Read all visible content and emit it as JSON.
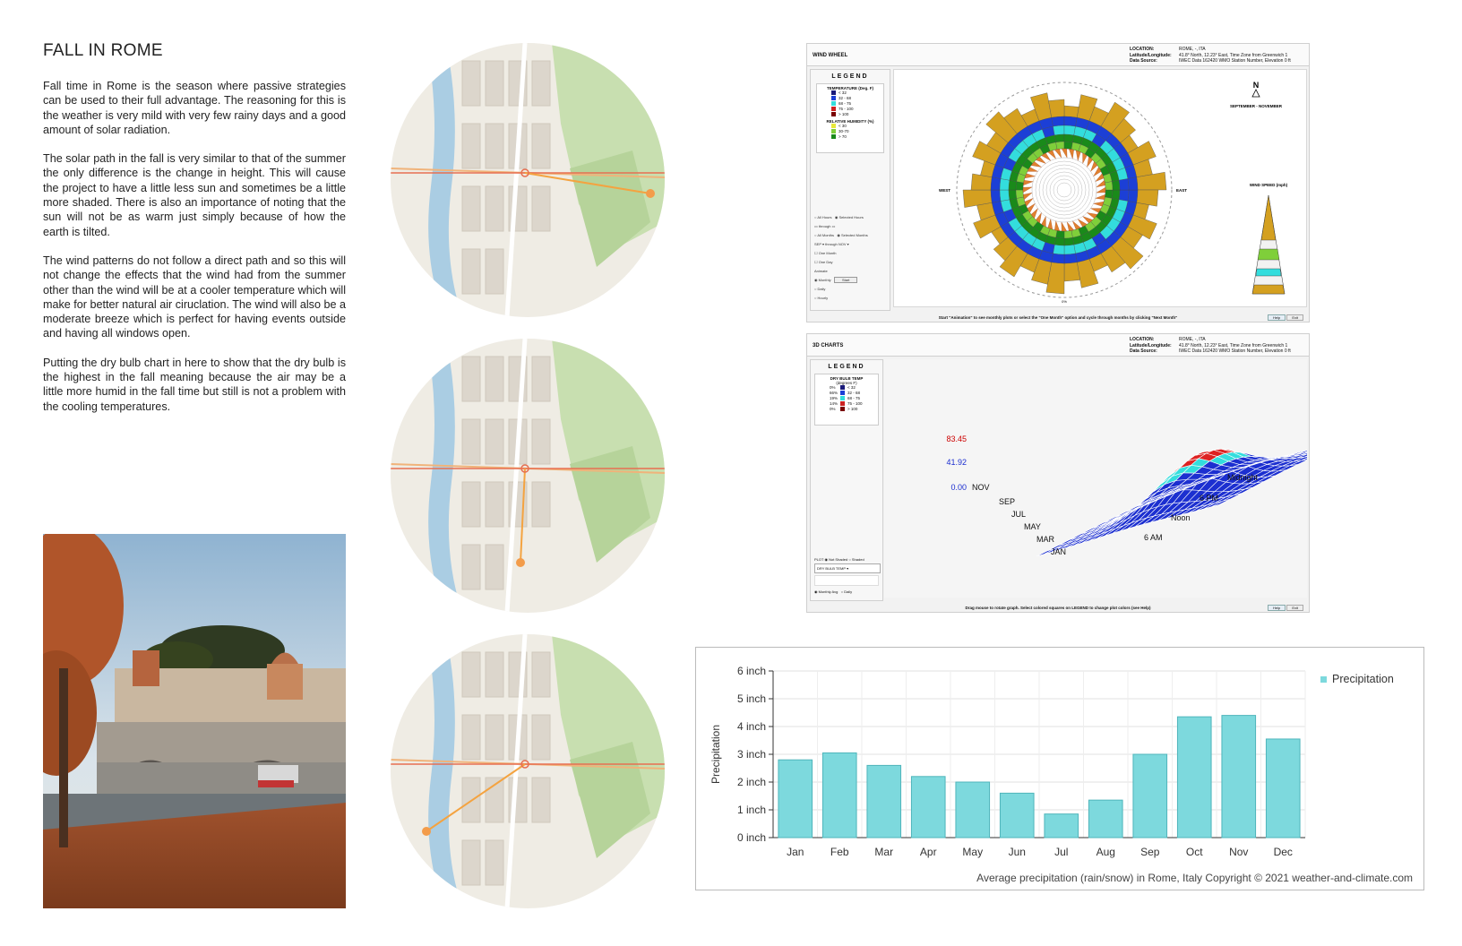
{
  "page": {
    "title": "FALL IN ROME",
    "paragraphs": [
      "Fall time in Rome is the season where passive strategies can be used to their full advantage. The reasoning for this is the weather is very mild with very few rainy days and a good amount of solar radiation.",
      "The solar path in the fall is very similar to that of the summer the only difference is the change in height. This will cause the project to have a little less sun and sometimes be a little more shaded. There is also an importance of noting that the sun will not be as warm just simply because of how the earth is tilted.",
      "The wind patterns do not follow a direct path and so this will not change the effects that the wind had from the summer other than the wind will be at a cooler temperature which will make for better natural air ciruclation. The wind will also be a moderate breeze which is perfect for having events outside and having all windows open.",
      "Putting the dry bulb chart in here to show that the dry bulb is the highest in the fall meaning because the air may be a little more humid in the fall time but still is not a problem with the cooling temperatures."
    ]
  },
  "wind_wheel": {
    "title": "WIND WHEEL",
    "location_labels": [
      "LOCATION:",
      "Latitude/Longitude:",
      "Data Source:"
    ],
    "location_values": [
      "ROME, -, ITA",
      "41.8° North, 12.23° East, Time Zone from Greenwich 1",
      "IWEC Data   162420 WMO Station Number, Elevation 0 ft"
    ],
    "legend_title": "LEGEND",
    "temp_title": "TEMPERATURE (Deg. F)",
    "temp_items": [
      {
        "label": "< 32",
        "color": "#1a1a7a"
      },
      {
        "label": "32 - 68",
        "color": "#1c3fd6"
      },
      {
        "label": "68 - 75",
        "color": "#33dddd"
      },
      {
        "label": "75 - 100",
        "color": "#cc2222"
      },
      {
        "label": "> 100",
        "color": "#7a0000"
      }
    ],
    "rh_title": "RELATIVE HUMIDITY (%)",
    "rh_items": [
      {
        "label": "< 30",
        "color": "#e8e83a"
      },
      {
        "label": "30-70",
        "color": "#7fcf3a"
      },
      {
        "label": "> 70",
        "color": "#1a8a1a"
      }
    ],
    "north": "N",
    "west": "WEST",
    "east": "EAST",
    "south": "0%",
    "season": "SEPTEMBER - NOVEMBER",
    "speed_label": "WIND SPEED (mph)",
    "footer": "Start \"Animation\" to see monthly plots or select the \"One Month\" option and cycle through months by clicking \"Next Month\"",
    "controls": [
      "All Hours",
      "Selected Hours",
      "All Months",
      "Selected Months",
      "One Month",
      "One Day",
      "Animate",
      "Monthly",
      "Daily",
      "Hourly",
      "Start",
      "SEP",
      "NOV",
      "through"
    ],
    "buttons": [
      "Help",
      "Exit"
    ]
  },
  "charts_3d": {
    "title": "3D CHARTS",
    "location_labels": [
      "LOCATION:",
      "Latitude/Longitude:",
      "Data Source:"
    ],
    "location_values": [
      "ROME, -, ITA",
      "41.8° North, 12.23° East, Time Zone from Greenwich 1",
      "IWEC Data   162420 WMO Station Number, Elevation 0 ft"
    ],
    "legend_title": "LEGEND",
    "drybulb_title": "DRY BULB TEMP",
    "drybulb_unit": "(degrees F)",
    "drybulb_items": [
      {
        "pct": "0%",
        "label": "< 32",
        "color": "#1a1a7a"
      },
      {
        "pct": "66%",
        "label": "32 - 68",
        "color": "#1c3fd6"
      },
      {
        "pct": "19%",
        "label": "68 - 75",
        "color": "#33dddd"
      },
      {
        "pct": "14%",
        "label": "75 - 100",
        "color": "#cc2222"
      },
      {
        "pct": "0%",
        "label": "> 100",
        "color": "#7a0000"
      }
    ],
    "plot_label": "PLOT",
    "plot_options": [
      "Not Shaded",
      "Shaded"
    ],
    "select_value": "DRY BULB TEMP",
    "avg_options": [
      "Monthly Avg",
      "Daily"
    ],
    "z_labels": [
      "83.45",
      "41.92",
      "0.00"
    ],
    "month_labels": [
      "NOV",
      "SEP",
      "JUL",
      "MAY",
      "MAR",
      "JAN"
    ],
    "hour_labels": [
      "Midnight",
      "6 PM",
      "Noon",
      "6 AM"
    ],
    "footer": "Drag mouse to rotate graph.  Select colored squares on LEGEND to change plot colors (see Help)",
    "buttons": [
      "Help",
      "Exit"
    ]
  },
  "chart_data": {
    "type": "bar",
    "categories": [
      "Jan",
      "Feb",
      "Mar",
      "Apr",
      "May",
      "Jun",
      "Jul",
      "Aug",
      "Sep",
      "Oct",
      "Nov",
      "Dec"
    ],
    "series": [
      {
        "name": "Precipitation",
        "values": [
          2.8,
          3.05,
          2.6,
          2.2,
          2.0,
          1.6,
          0.85,
          1.35,
          3.0,
          4.35,
          4.4,
          3.55
        ],
        "color": "#7dd9dd"
      }
    ],
    "ylabel": "Precipitation",
    "ytick_labels": [
      "0 inch",
      "1 inch",
      "2 inch",
      "3 inch",
      "4 inch",
      "5 inch",
      "6 inch"
    ],
    "ylim": [
      0,
      6
    ],
    "grid": true,
    "legend_position": "top-right",
    "caption": "Average precipitation (rain/snow) in Rome, Italy   Copyright © 2021  weather-and-climate.com"
  }
}
